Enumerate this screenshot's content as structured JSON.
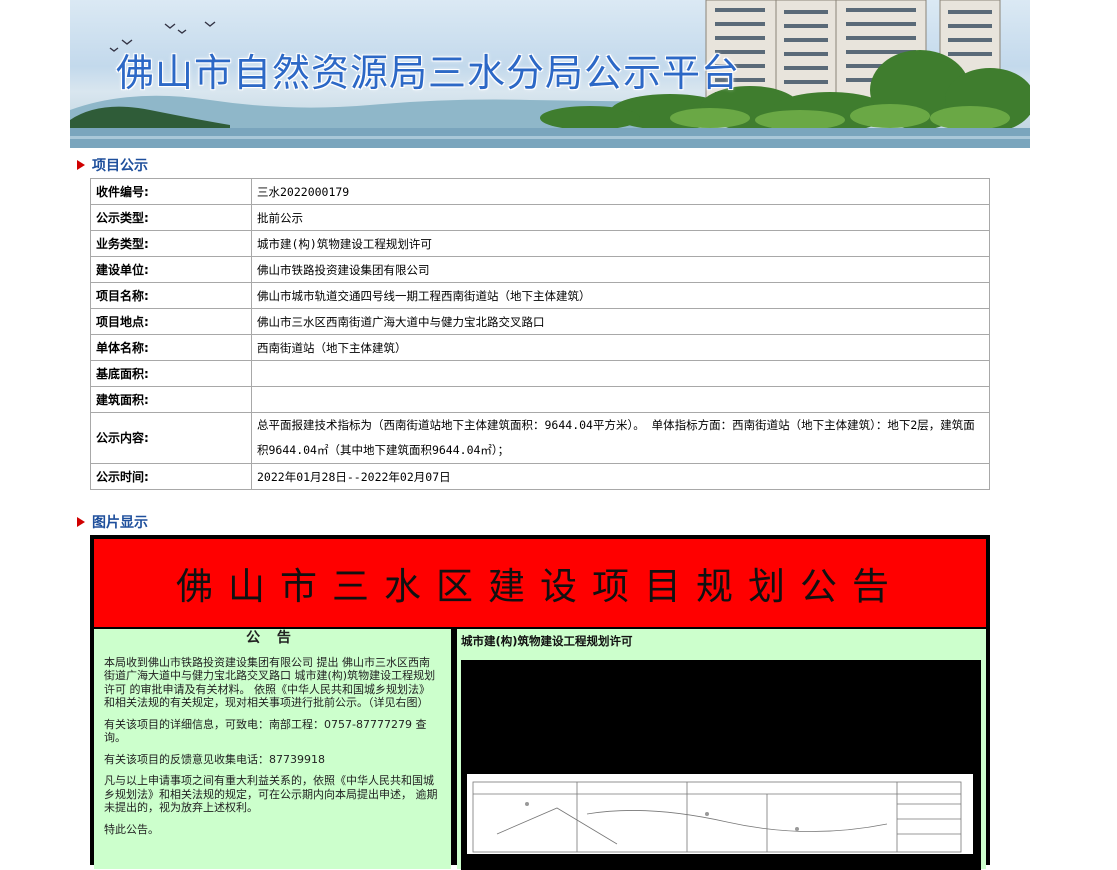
{
  "banner": {
    "title": "佛山市自然资源局三水分局公示平台"
  },
  "sections": {
    "project": "项目公示",
    "image": "图片显示"
  },
  "project_info": [
    {
      "label": "收件编号:",
      "value": "三水2022000179"
    },
    {
      "label": "公示类型:",
      "value": "批前公示"
    },
    {
      "label": "业务类型:",
      "value": "城市建(构)筑物建设工程规划许可"
    },
    {
      "label": "建设单位:",
      "value": "佛山市铁路投资建设集团有限公司"
    },
    {
      "label": "项目名称:",
      "value": "佛山市城市轨道交通四号线一期工程西南街道站（地下主体建筑）"
    },
    {
      "label": "项目地点:",
      "value": "佛山市三水区西南街道广海大道中与健力宝北路交叉路口"
    },
    {
      "label": "单体名称:",
      "value": "西南街道站（地下主体建筑）"
    },
    {
      "label": "基底面积:",
      "value": ""
    },
    {
      "label": "建筑面积:",
      "value": ""
    },
    {
      "label": "公示内容:",
      "value": "总平面报建技术指标为（西南街道站地下主体建筑面积：9644.04平方米）。 单体指标方面：西南街道站（地下主体建筑）：地下2层，建筑面积9644.04㎡（其中地下建筑面积9644.04㎡）；"
    },
    {
      "label": "公示时间:",
      "value": "2022年01月28日--2022年02月07日"
    }
  ],
  "poster": {
    "headline": "佛山市三水区建设项目规划公告",
    "notice_heading": "公 告",
    "paragraphs": [
      "本局收到佛山市铁路投资建设集团有限公司 提出 佛山市三水区西南街道广海大道中与健力宝北路交叉路口 城市建(构)筑物建设工程规划许可 的审批申请及有关材料。 依照《中华人民共和国城乡规划法》和相关法规的有关规定，现对相关事项进行批前公示。（详见右图）",
      "有关该项目的详细信息，可致电：南部工程：0757-87777279 查询。",
      "有关该项目的反馈意见收集电话：87739918",
      "凡与以上申请事项之间有重大利益关系的，依照《中华人民共和国城乡规划法》和相关法规的规定，可在公示期内向本局提出申述， 逾期未提出的，视为放弃上述权利。",
      "特此公告。"
    ],
    "right_title": "城市建(构)筑物建设工程规划许可"
  },
  "colors": {
    "section_text": "#1e4f9c",
    "arrow": "#d00000",
    "poster_red": "#ff0000",
    "poster_green": "#ccffcc"
  }
}
